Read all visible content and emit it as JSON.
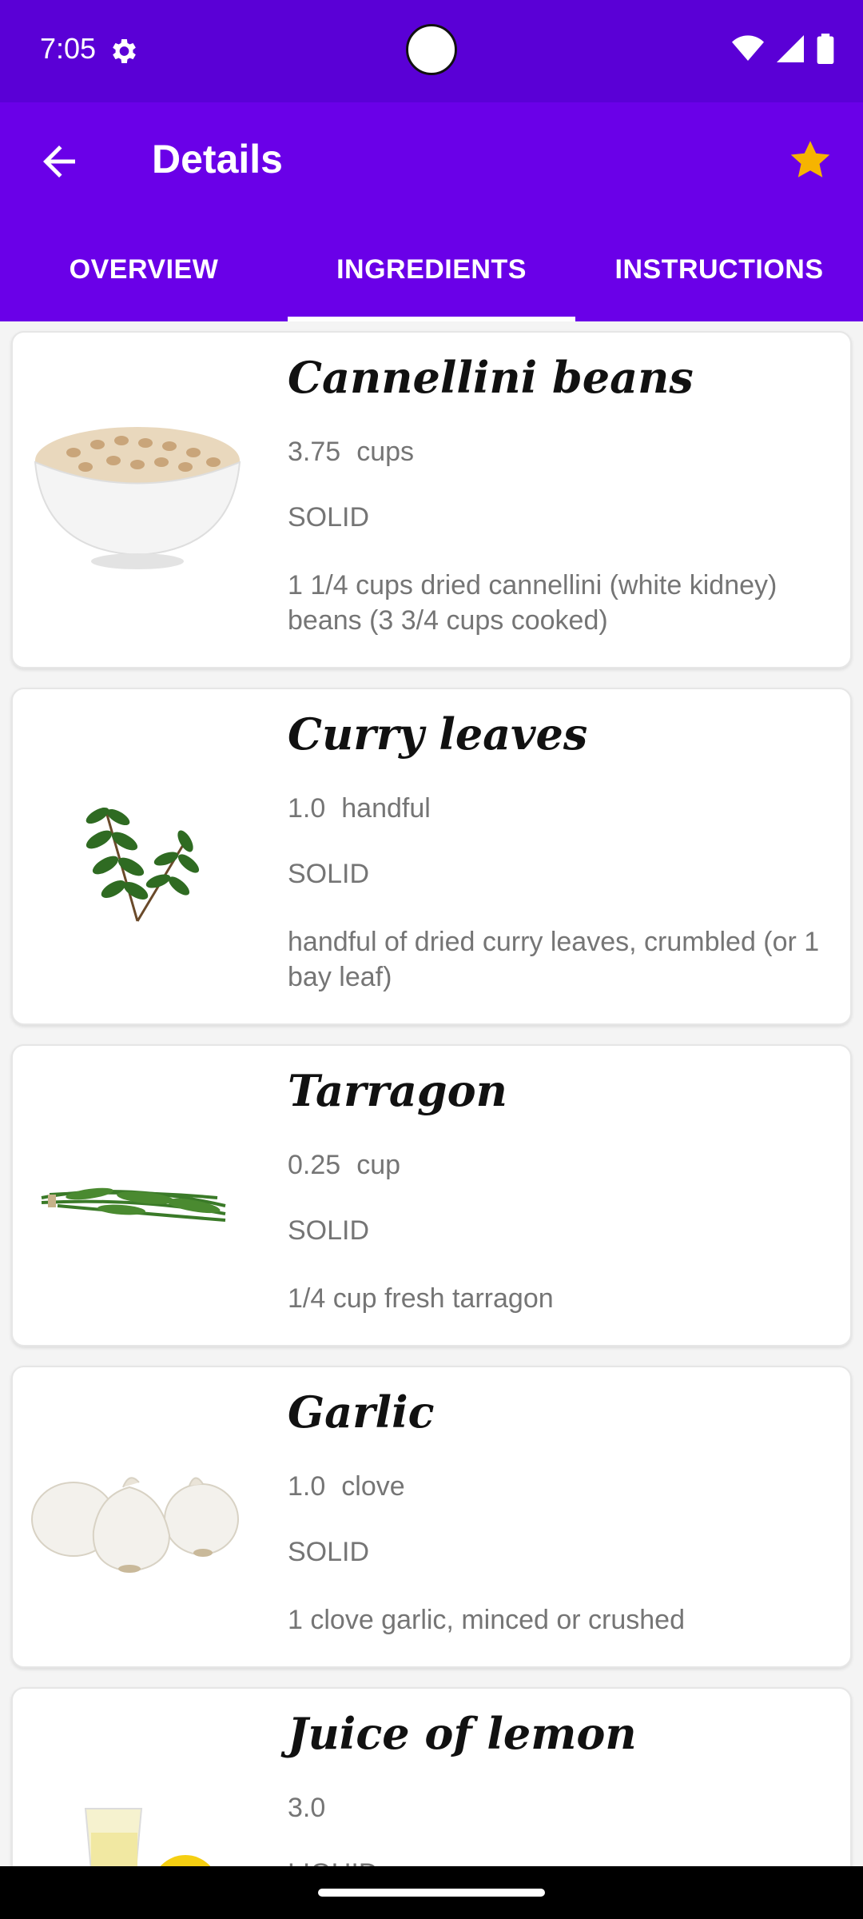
{
  "status_bar": {
    "time": "7:05"
  },
  "app_bar": {
    "title": "Details"
  },
  "tabs": [
    {
      "label": "OVERVIEW",
      "active": false
    },
    {
      "label": "INGREDIENTS",
      "active": true
    },
    {
      "label": "INSTRUCTIONS",
      "active": false
    }
  ],
  "ingredients": [
    {
      "name": "Cannellini beans",
      "amount": "3.75",
      "unit": "cups",
      "type": "SOLID",
      "description": "1 1/4 cups dried cannellini (white kidney) beans (3 3/4 cups cooked)"
    },
    {
      "name": "Curry leaves",
      "amount": "1.0",
      "unit": "handful",
      "type": "SOLID",
      "description": "handful of dried curry leaves, crumbled (or 1 bay leaf)"
    },
    {
      "name": "Tarragon",
      "amount": "0.25",
      "unit": "cup",
      "type": "SOLID",
      "description": "1/4 cup fresh tarragon"
    },
    {
      "name": "Garlic",
      "amount": "1.0",
      "unit": "clove",
      "type": "SOLID",
      "description": "1 clove garlic, minced or crushed"
    },
    {
      "name": "Juice of lemon",
      "amount": "3.0",
      "unit": "",
      "type": "LIQUID",
      "description": ""
    }
  ],
  "colors": {
    "status_bar": "#5a00d6",
    "app_bar": "#6a00e8",
    "star": "#f6b400"
  },
  "icons": [
    "settings-gear-icon",
    "wifi-icon",
    "signal-icon",
    "battery-icon",
    "back-arrow-icon",
    "star-icon"
  ]
}
